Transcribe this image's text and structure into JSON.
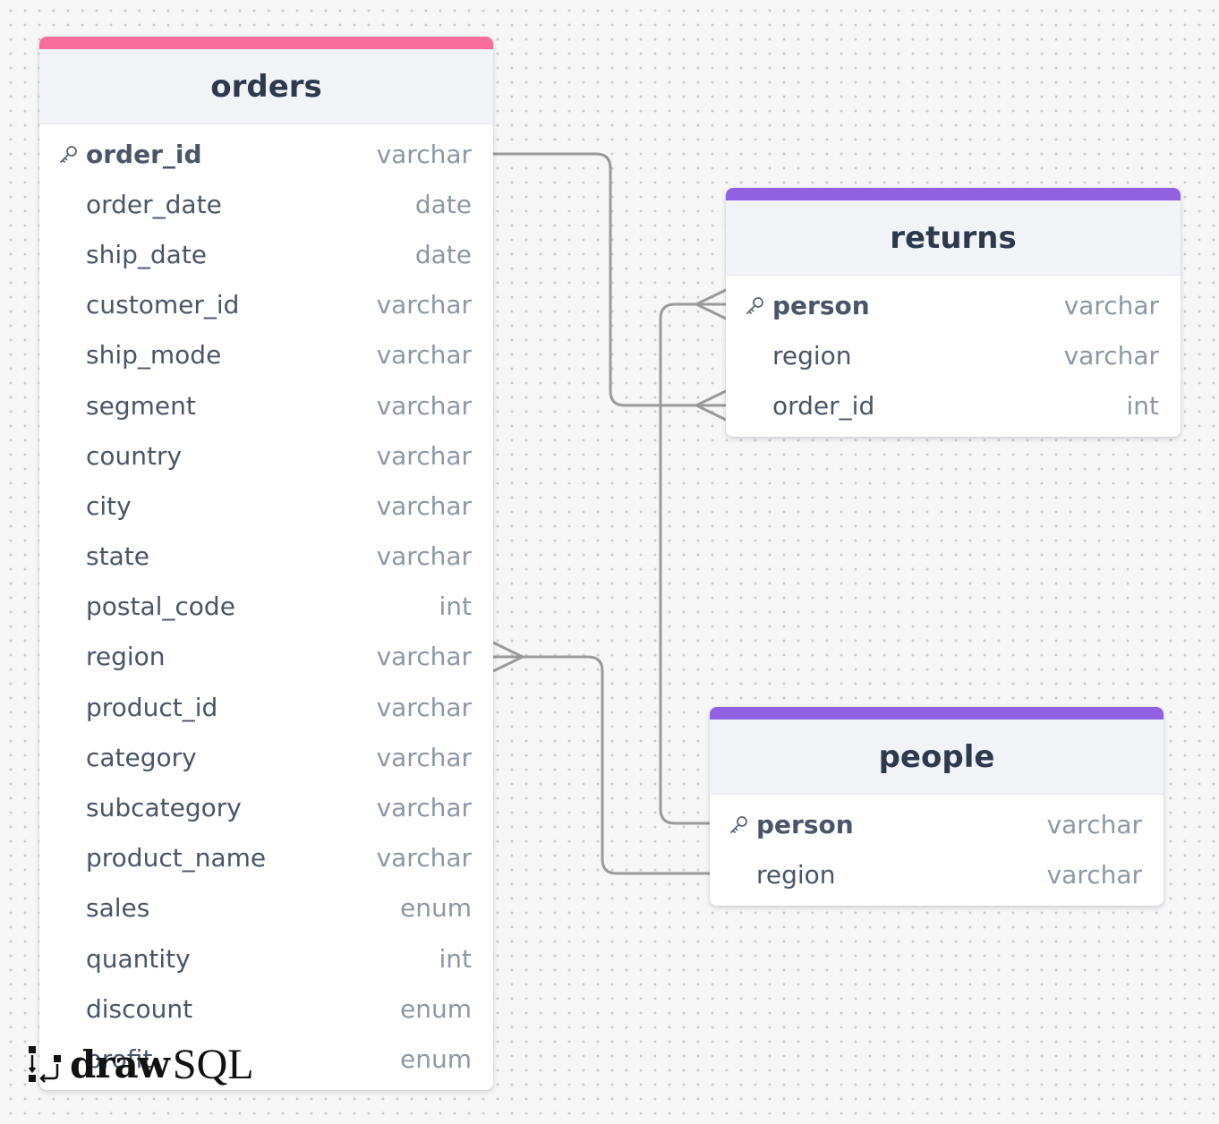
{
  "colors": {
    "orders_accent": "#f76e9d",
    "returns_accent": "#9061e0",
    "people_accent": "#9061e0",
    "connector": "#9a9a9a"
  },
  "tables": {
    "orders": {
      "title": "orders",
      "columns": [
        {
          "name": "order_id",
          "type": "varchar",
          "pk": true
        },
        {
          "name": "order_date",
          "type": "date"
        },
        {
          "name": "ship_date",
          "type": "date"
        },
        {
          "name": "customer_id",
          "type": "varchar"
        },
        {
          "name": "ship_mode",
          "type": "varchar"
        },
        {
          "name": "segment",
          "type": "varchar"
        },
        {
          "name": "country",
          "type": "varchar"
        },
        {
          "name": "city",
          "type": "varchar"
        },
        {
          "name": "state",
          "type": "varchar"
        },
        {
          "name": "postal_code",
          "type": "int"
        },
        {
          "name": "region",
          "type": "varchar"
        },
        {
          "name": "product_id",
          "type": "varchar"
        },
        {
          "name": "category",
          "type": "varchar"
        },
        {
          "name": "subcategory",
          "type": "varchar"
        },
        {
          "name": "product_name",
          "type": "varchar"
        },
        {
          "name": "sales",
          "type": "enum"
        },
        {
          "name": "quantity",
          "type": "int"
        },
        {
          "name": "discount",
          "type": "enum"
        },
        {
          "name": "profit",
          "type": "enum"
        }
      ]
    },
    "returns": {
      "title": "returns",
      "columns": [
        {
          "name": "person",
          "type": "varchar",
          "pk": true
        },
        {
          "name": "region",
          "type": "varchar"
        },
        {
          "name": "order_id",
          "type": "int"
        }
      ]
    },
    "people": {
      "title": "people",
      "columns": [
        {
          "name": "person",
          "type": "varchar",
          "pk": true
        },
        {
          "name": "region",
          "type": "varchar"
        }
      ]
    }
  },
  "relations": [
    {
      "from": "orders.order_id",
      "to": "returns.order_id",
      "to_cardinality": "many"
    },
    {
      "from": "people.person",
      "to": "returns.person",
      "to_cardinality": "many"
    },
    {
      "from": "people.region",
      "to": "orders.region",
      "to_cardinality": "many"
    }
  ],
  "logo": {
    "part1": "draw",
    "part2": "SQL"
  }
}
